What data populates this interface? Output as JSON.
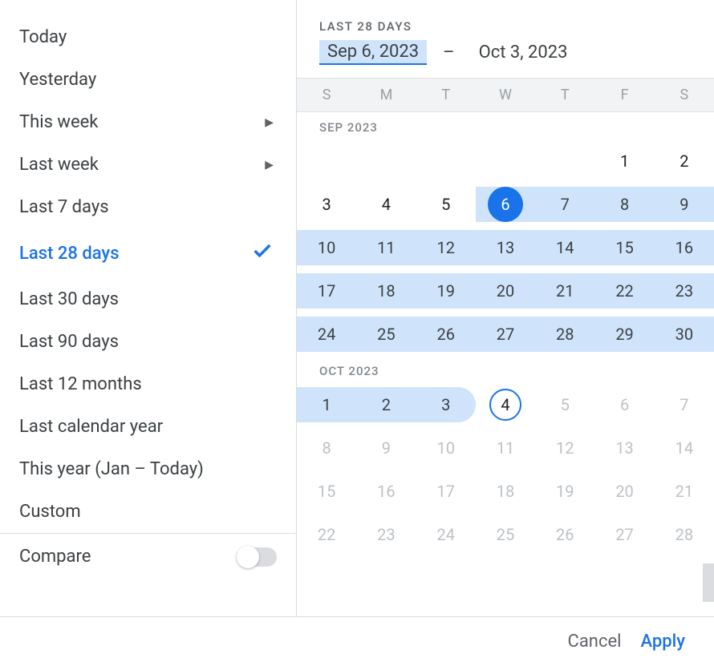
{
  "sidebar": {
    "presets": [
      {
        "label": "Today",
        "submenu": false,
        "selected": false
      },
      {
        "label": "Yesterday",
        "submenu": false,
        "selected": false
      },
      {
        "label": "This week",
        "submenu": true,
        "selected": false
      },
      {
        "label": "Last week",
        "submenu": true,
        "selected": false
      },
      {
        "label": "Last 7 days",
        "submenu": false,
        "selected": false
      },
      {
        "label": "Last 28 days",
        "submenu": false,
        "selected": true
      },
      {
        "label": "Last 30 days",
        "submenu": false,
        "selected": false
      },
      {
        "label": "Last 90 days",
        "submenu": false,
        "selected": false
      },
      {
        "label": "Last 12 months",
        "submenu": false,
        "selected": false
      },
      {
        "label": "Last calendar year",
        "submenu": false,
        "selected": false
      },
      {
        "label": "This year (Jan – Today)",
        "submenu": false,
        "selected": false
      },
      {
        "label": "Custom",
        "submenu": false,
        "selected": false
      }
    ],
    "compare_label": "Compare",
    "compare_on": false
  },
  "calendar": {
    "range_title": "LAST 28 DAYS",
    "start_text": "Sep 6, 2023",
    "end_text": "Oct 3, 2023",
    "separator": "–",
    "dow": [
      "S",
      "M",
      "T",
      "W",
      "T",
      "F",
      "S"
    ],
    "months": [
      {
        "label": "SEP 2023",
        "weeks": [
          [
            null,
            null,
            null,
            null,
            null,
            {
              "d": 1
            },
            {
              "d": 2
            }
          ],
          [
            {
              "d": 3
            },
            {
              "d": 4
            },
            {
              "d": 5
            },
            {
              "d": 6,
              "start": true,
              "in": true
            },
            {
              "d": 7,
              "in": true
            },
            {
              "d": 8,
              "in": true
            },
            {
              "d": 9,
              "in": true
            }
          ],
          [
            {
              "d": 10,
              "in": true
            },
            {
              "d": 11,
              "in": true
            },
            {
              "d": 12,
              "in": true
            },
            {
              "d": 13,
              "in": true
            },
            {
              "d": 14,
              "in": true
            },
            {
              "d": 15,
              "in": true
            },
            {
              "d": 16,
              "in": true
            }
          ],
          [
            {
              "d": 17,
              "in": true
            },
            {
              "d": 18,
              "in": true
            },
            {
              "d": 19,
              "in": true
            },
            {
              "d": 20,
              "in": true
            },
            {
              "d": 21,
              "in": true
            },
            {
              "d": 22,
              "in": true
            },
            {
              "d": 23,
              "in": true
            }
          ],
          [
            {
              "d": 24,
              "in": true
            },
            {
              "d": 25,
              "in": true
            },
            {
              "d": 26,
              "in": true
            },
            {
              "d": 27,
              "in": true
            },
            {
              "d": 28,
              "in": true
            },
            {
              "d": 29,
              "in": true
            },
            {
              "d": 30,
              "in": true
            }
          ]
        ]
      },
      {
        "label": "OCT 2023",
        "weeks": [
          [
            {
              "d": 1,
              "in": true
            },
            {
              "d": 2,
              "in": true
            },
            {
              "d": 3,
              "in": true,
              "end": true
            },
            {
              "d": 4,
              "today": true
            },
            {
              "d": 5,
              "disabled": true
            },
            {
              "d": 6,
              "disabled": true
            },
            {
              "d": 7,
              "disabled": true
            }
          ],
          [
            {
              "d": 8,
              "disabled": true
            },
            {
              "d": 9,
              "disabled": true
            },
            {
              "d": 10,
              "disabled": true
            },
            {
              "d": 11,
              "disabled": true
            },
            {
              "d": 12,
              "disabled": true
            },
            {
              "d": 13,
              "disabled": true
            },
            {
              "d": 14,
              "disabled": true
            }
          ],
          [
            {
              "d": 15,
              "disabled": true
            },
            {
              "d": 16,
              "disabled": true
            },
            {
              "d": 17,
              "disabled": true
            },
            {
              "d": 18,
              "disabled": true
            },
            {
              "d": 19,
              "disabled": true
            },
            {
              "d": 20,
              "disabled": true
            },
            {
              "d": 21,
              "disabled": true
            }
          ],
          [
            {
              "d": 22,
              "disabled": true
            },
            {
              "d": 23,
              "disabled": true
            },
            {
              "d": 24,
              "disabled": true
            },
            {
              "d": 25,
              "disabled": true
            },
            {
              "d": 26,
              "disabled": true
            },
            {
              "d": 27,
              "disabled": true
            },
            {
              "d": 28,
              "disabled": true
            }
          ]
        ]
      }
    ]
  },
  "footer": {
    "cancel": "Cancel",
    "apply": "Apply"
  }
}
